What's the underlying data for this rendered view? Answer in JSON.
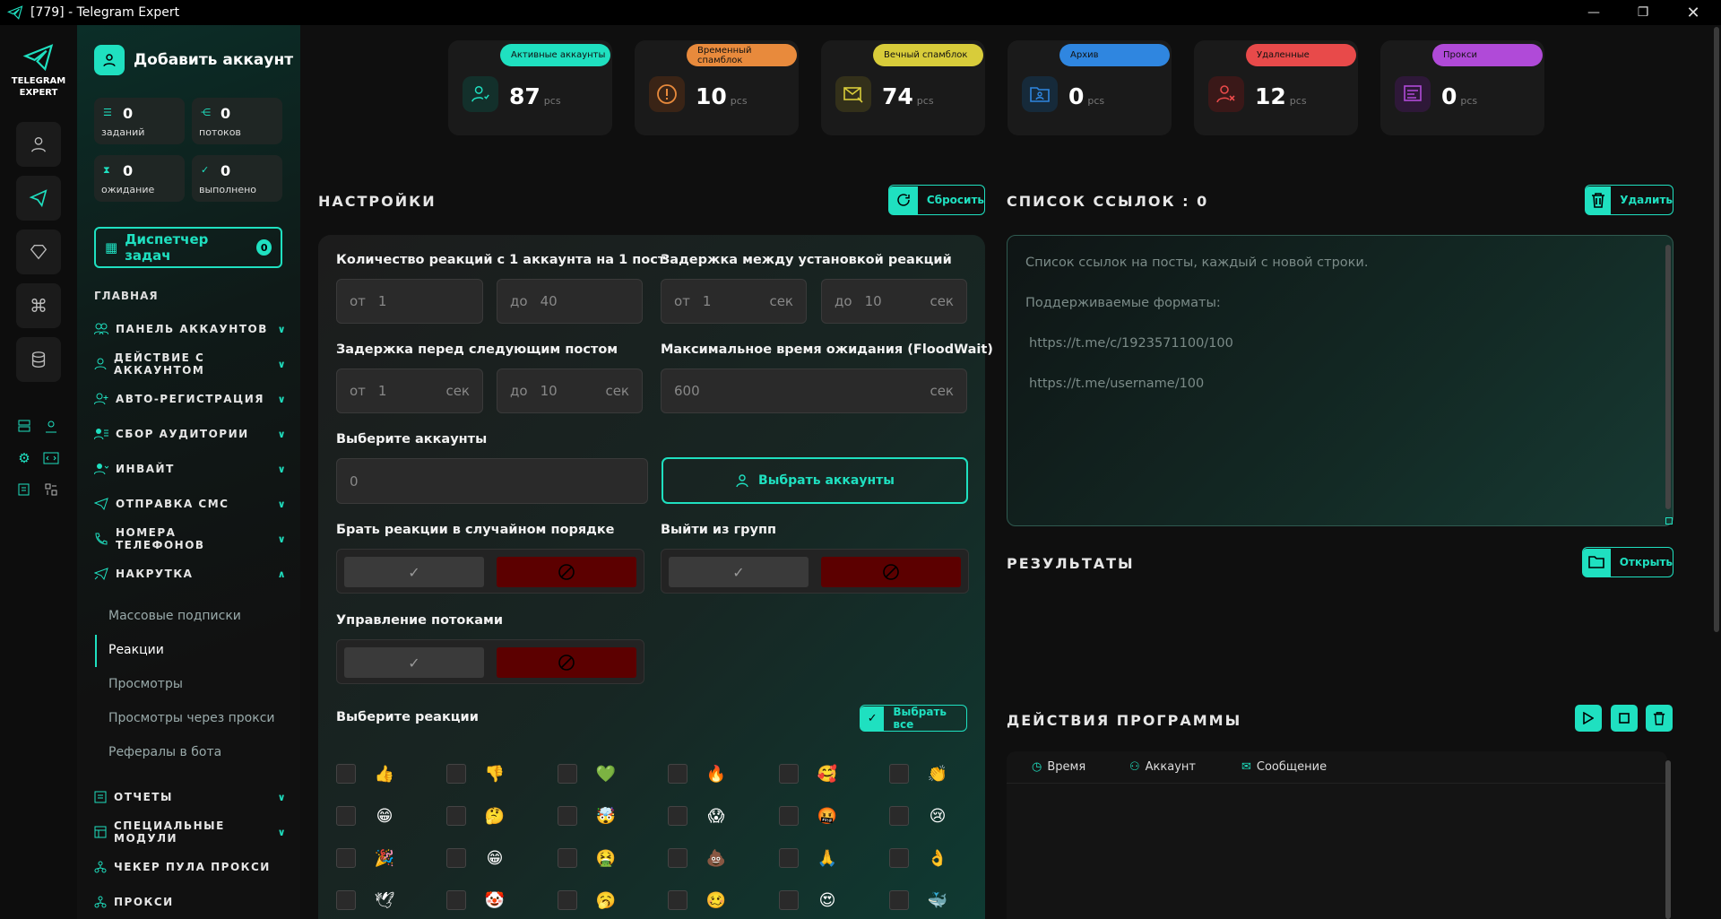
{
  "window": {
    "title": "[779] - Telegram Expert"
  },
  "brand": {
    "line1": "TELEGRAM",
    "line2": "EXPERT"
  },
  "sidebar": {
    "add_account": "Добавить аккаунт",
    "stats": [
      {
        "value": "0",
        "label": "заданий"
      },
      {
        "value": "0",
        "label": "потоков"
      },
      {
        "value": "0",
        "label": "ожидание"
      },
      {
        "value": "0",
        "label": "выполнено"
      }
    ],
    "dispatcher": {
      "label": "Диспетчер задач",
      "count": "0"
    },
    "section": "ГЛАВНАЯ",
    "nav": [
      {
        "label": "ПАНЕЛЬ АККАУНТОВ",
        "icon": "users-icon",
        "chev": "∨"
      },
      {
        "label": "ДЕЙСТВИЕ С АККАУНТОМ",
        "icon": "user-icon",
        "chev": "∨"
      },
      {
        "label": "АВТО-РЕГИСТРАЦИЯ",
        "icon": "user-plus-icon",
        "chev": "∨"
      },
      {
        "label": "СБОР АУДИТОРИИ",
        "icon": "audience-icon",
        "chev": "∨"
      },
      {
        "label": "ИНВАЙТ",
        "icon": "invite-icon",
        "chev": "∨"
      },
      {
        "label": "ОТПРАВКА СМС",
        "icon": "send-icon",
        "chev": "∨"
      },
      {
        "label": "НОМЕРА ТЕЛЕФОНОВ",
        "icon": "phone-icon",
        "chev": "∨"
      },
      {
        "label": "НАКРУТКА",
        "icon": "boost-icon",
        "chev": "∧"
      }
    ],
    "sub": [
      {
        "label": "Массовые подписки"
      },
      {
        "label": "Реакции"
      },
      {
        "label": "Просмотры"
      },
      {
        "label": "Просмотры через прокси"
      },
      {
        "label": "Рефералы в бота"
      }
    ],
    "nav2": [
      {
        "label": "ОТЧЕТЫ",
        "icon": "report-icon",
        "chev": "∨"
      },
      {
        "label": "СПЕЦИАЛЬНЫЕ МОДУЛИ",
        "icon": "modules-icon",
        "chev": "∨"
      },
      {
        "label": "ЧЕКЕР ПУЛА ПРОКСИ",
        "icon": "proxy-checker-icon",
        "chev": ""
      },
      {
        "label": "ПРОКСИ",
        "icon": "proxy-icon",
        "chev": ""
      }
    ]
  },
  "cards": [
    {
      "label": "Активные аккаунты",
      "value": "87",
      "unit": "pcs",
      "color": "#1fe0c0"
    },
    {
      "label": "Временный спамблок",
      "value": "10",
      "unit": "pcs",
      "color": "#e88a3c"
    },
    {
      "label": "Вечный спамблок",
      "value": "74",
      "unit": "pcs",
      "color": "#d8cc3a"
    },
    {
      "label": "Архив",
      "value": "0",
      "unit": "pcs",
      "color": "#2f86e0"
    },
    {
      "label": "Удаленные",
      "value": "12",
      "unit": "pcs",
      "color": "#e84a4a"
    },
    {
      "label": "Прокси",
      "value": "0",
      "unit": "pcs",
      "color": "#b04ad8"
    }
  ],
  "settings": {
    "title": "НАСТРОЙКИ",
    "reset": "Сбросить",
    "reactions_count": {
      "label": "Количество реакций с 1 аккаунта на 1 пост",
      "from_pre": "от",
      "from": "1",
      "to_pre": "до",
      "to": "40"
    },
    "reaction_delay": {
      "label": "Задержка между установкой реакций",
      "from_pre": "от",
      "from": "1",
      "to_pre": "до",
      "to": "10",
      "unit": "сек"
    },
    "post_delay": {
      "label": "Задержка перед следующим постом",
      "from_pre": "от",
      "from": "1",
      "to_pre": "до",
      "to": "10",
      "unit": "сек"
    },
    "floodwait": {
      "label": "Максимальное время ожидания (FloodWait)",
      "value": "600",
      "unit": "сек"
    },
    "accounts": {
      "label": "Выберите аккаунты",
      "value": "0",
      "button": "Выбрать аккаунты"
    },
    "random_order": {
      "label": "Брать реакции в случайном порядке"
    },
    "leave_groups": {
      "label": "Выйти из групп"
    },
    "threads": {
      "label": "Управление потоками"
    },
    "reactions": {
      "label": "Выберите реакции",
      "select_all": "Выбрать все"
    },
    "emojis": [
      "👍",
      "👎",
      "💚",
      "🔥",
      "🥰",
      "👏",
      "😁",
      "🤔",
      "🤯",
      "😱",
      "🤬",
      "😢",
      "🎉",
      "😁",
      "🤮",
      "💩",
      "🙏",
      "👌",
      "🕊",
      "🤡",
      "🥱",
      "🥴",
      "😍",
      "🐳"
    ]
  },
  "links": {
    "title": "СПИСОК ССЫЛОК : 0",
    "delete": "Удалить",
    "ph1": "Список ссылок на посты, каждый с новой строки.",
    "ph2": "Поддерживаемые форматы:",
    "ph3": "https://t.me/c/1923571100/100",
    "ph4": "https://t.me/username/100"
  },
  "results": {
    "title": "РЕЗУЛЬТАТЫ",
    "open": "Открыть"
  },
  "actions": {
    "title": "ДЕЙСТВИЯ ПРОГРАММЫ",
    "col_time": "Время",
    "col_account": "Аккаунт",
    "col_message": "Сообщение"
  },
  "colors": {
    "accent": "#1fe0c0",
    "danger": "#5c0000"
  }
}
